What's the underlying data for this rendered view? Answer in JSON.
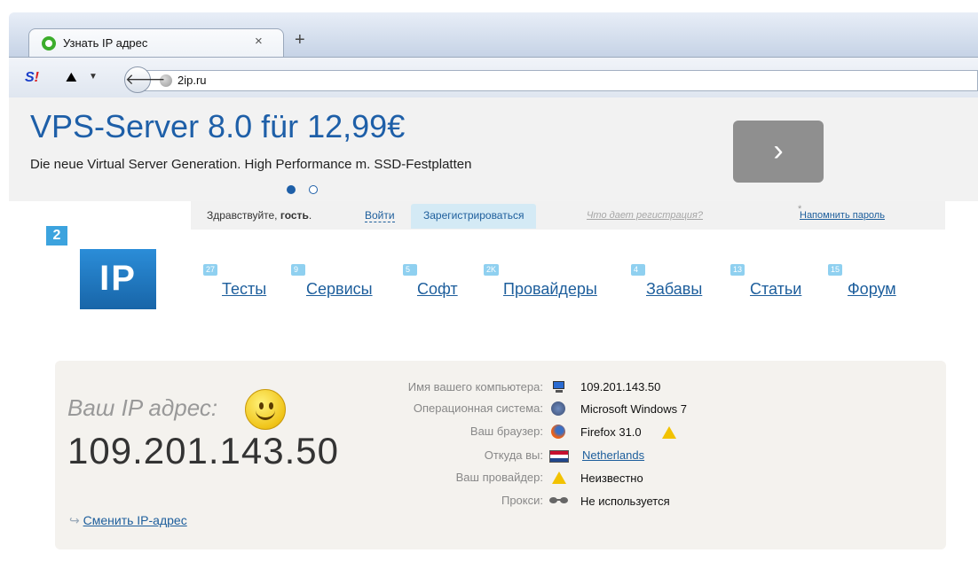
{
  "browser": {
    "tab_title": "Узнать IP адрес",
    "tab_close": "×",
    "new_tab": "+",
    "url": "2ip.ru"
  },
  "ad": {
    "title": "VPS-Server 8.0 für 12,99€",
    "subtitle": "Die neue Virtual Server Generation. High Performance m. SSD-Festplatten",
    "next_glyph": "›"
  },
  "userbar": {
    "greeting": "Здравствуйте,",
    "guest": "гость",
    "login": "Войти",
    "register": "Зарегистрироваться",
    "register_why": "Что дает регистрация?",
    "remind_password": "Напомнить пароль"
  },
  "logo": {
    "badge": "2",
    "text": "IP"
  },
  "menu": [
    {
      "label": "Тесты",
      "badge": "27"
    },
    {
      "label": "Сервисы",
      "badge": "9"
    },
    {
      "label": "Софт",
      "badge": "5"
    },
    {
      "label": "Провайдеры",
      "badge": "2K"
    },
    {
      "label": "Забавы",
      "badge": "4"
    },
    {
      "label": "Статьи",
      "badge": "13"
    },
    {
      "label": "Форум",
      "badge": "15"
    }
  ],
  "ip_card": {
    "label": "Ваш IP адрес:",
    "ip": "109.201.143.50",
    "change_ip": "Сменить IP-адрес",
    "change_arrow": "↪"
  },
  "info": [
    {
      "label": "Имя вашего компьютера:",
      "value": "109.201.143.50",
      "icon": "computer-icon"
    },
    {
      "label": "Операционная система:",
      "value": "Microsoft Windows 7",
      "icon": "windows-icon"
    },
    {
      "label": "Ваш браузер:",
      "value": "Firefox 31.0",
      "icon": "firefox-icon"
    },
    {
      "label": "Откуда вы:",
      "value": "Netherlands",
      "icon": "netherlands-flag-icon"
    },
    {
      "label": "Ваш провайдер:",
      "value": "Неизвестно",
      "icon": "warning-icon"
    },
    {
      "label": "Прокси:",
      "value": "Не используется",
      "icon": "glasses-icon"
    }
  ]
}
